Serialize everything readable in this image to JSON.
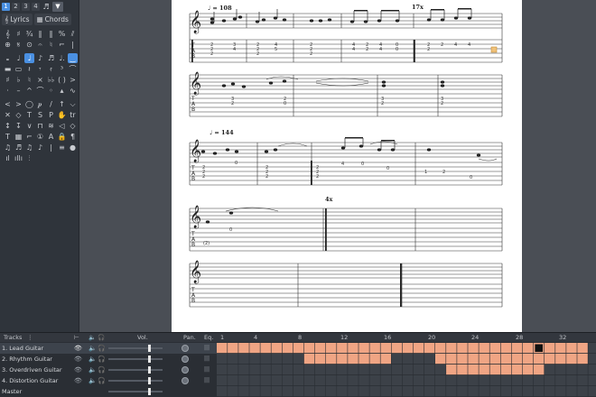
{
  "palette": {
    "voices": [
      "1",
      "2",
      "3",
      "4"
    ],
    "tabs": [
      "Lyrics",
      "Chords"
    ]
  },
  "score": {
    "tempo1": "♩ = 108",
    "tempo2": "♩ = 144",
    "repeat1": "17x",
    "repeat2": "4x"
  },
  "tracks": {
    "header": {
      "tracks": "Tracks",
      "vol": "Vol.",
      "pan": "Pan.",
      "eq": "Eq."
    },
    "list": [
      {
        "name": "1. Lead Guitar"
      },
      {
        "name": "2. Rhythm Guitar"
      },
      {
        "name": "3. Overdriven Guitar"
      },
      {
        "name": "4. Distortion Guitar"
      },
      {
        "name": "Master"
      }
    ],
    "bar_numbers": [
      "1",
      "4",
      "8",
      "12",
      "16",
      "20",
      "24",
      "28",
      "32"
    ]
  },
  "colors": {
    "clip": "#f0a584",
    "accent": "#4a90e2"
  }
}
